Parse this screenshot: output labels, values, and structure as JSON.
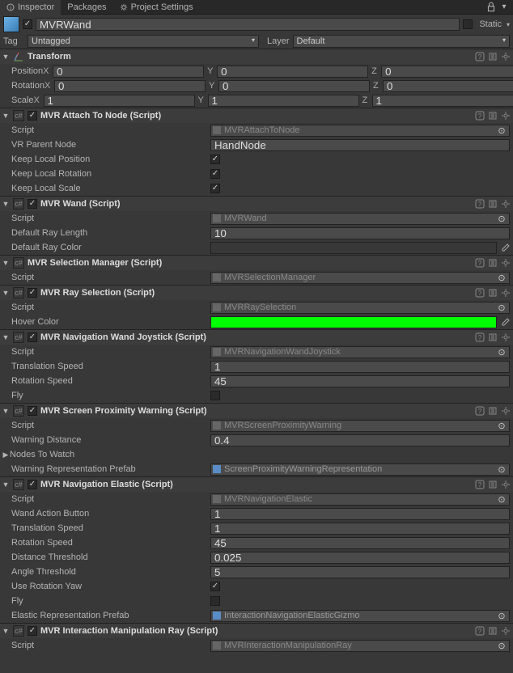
{
  "tabs": {
    "inspector": "Inspector",
    "packages": "Packages",
    "projectSettings": "Project Settings"
  },
  "header": {
    "nameChecked": true,
    "name": "MVRWand",
    "staticLabel": "Static",
    "staticChecked": false
  },
  "tagRow": {
    "tagLabel": "Tag",
    "tagValue": "Untagged",
    "layerLabel": "Layer",
    "layerValue": "Default"
  },
  "transform": {
    "title": "Transform",
    "positionLabel": "Position",
    "position": {
      "x": "0",
      "y": "0",
      "z": "0"
    },
    "rotationLabel": "Rotation",
    "rotation": {
      "x": "0",
      "y": "0",
      "z": "0"
    },
    "scaleLabel": "Scale",
    "scale": {
      "x": "1",
      "y": "1",
      "z": "1"
    }
  },
  "attachToNode": {
    "title": "MVR Attach To Node (Script)",
    "enabled": true,
    "scriptLabel": "Script",
    "scriptValue": "MVRAttachToNode",
    "parentLabel": "VR Parent Node",
    "parentValue": "HandNode",
    "keepPosLabel": "Keep Local Position",
    "keepPos": true,
    "keepRotLabel": "Keep Local Rotation",
    "keepRot": true,
    "keepScaleLabel": "Keep Local Scale",
    "keepScale": true
  },
  "wand": {
    "title": "MVR Wand (Script)",
    "enabled": true,
    "scriptLabel": "Script",
    "scriptValue": "MVRWand",
    "rayLenLabel": "Default Ray Length",
    "rayLen": "10",
    "rayColorLabel": "Default Ray Color",
    "rayColor": "#ffffff"
  },
  "selMgr": {
    "title": "MVR Selection Manager (Script)",
    "enabled": false,
    "scriptLabel": "Script",
    "scriptValue": "MVRSelectionManager"
  },
  "raySel": {
    "title": "MVR Ray Selection (Script)",
    "enabled": true,
    "scriptLabel": "Script",
    "scriptValue": "MVRRaySelection",
    "hoverLabel": "Hover Color",
    "hoverColor": "#00ff00"
  },
  "navJoy": {
    "title": "MVR Navigation Wand Joystick (Script)",
    "enabled": true,
    "scriptLabel": "Script",
    "scriptValue": "MVRNavigationWandJoystick",
    "transSpeedLabel": "Translation Speed",
    "transSpeed": "1",
    "rotSpeedLabel": "Rotation Speed",
    "rotSpeed": "45",
    "flyLabel": "Fly",
    "fly": false
  },
  "proxWarn": {
    "title": "MVR Screen Proximity Warning (Script)",
    "enabled": true,
    "scriptLabel": "Script",
    "scriptValue": "MVRScreenProximityWarning",
    "distLabel": "Warning Distance",
    "dist": "0.4",
    "nodesLabel": "Nodes To Watch",
    "reprLabel": "Warning Representation Prefab",
    "reprValue": "ScreenProximityWarningRepresentation"
  },
  "navElastic": {
    "title": "MVR Navigation Elastic (Script)",
    "enabled": true,
    "scriptLabel": "Script",
    "scriptValue": "MVRNavigationElastic",
    "btnLabel": "Wand Action Button",
    "btn": "1",
    "transSpeedLabel": "Translation Speed",
    "transSpeed": "1",
    "rotSpeedLabel": "Rotation Speed",
    "rotSpeed": "45",
    "distThreshLabel": "Distance Threshold",
    "distThresh": "0.025",
    "angleThreshLabel": "Angle Threshold",
    "angleThresh": "5",
    "yawLabel": "Use Rotation Yaw",
    "yaw": true,
    "flyLabel": "Fly",
    "fly": false,
    "reprLabel": "Elastic Representation Prefab",
    "reprValue": "InteractionNavigationElasticGizmo"
  },
  "manipRay": {
    "title": "MVR Interaction Manipulation Ray (Script)",
    "enabled": true,
    "scriptLabel": "Script",
    "scriptValue": "MVRInteractionManipulationRay"
  },
  "axes": {
    "x": "X",
    "y": "Y",
    "z": "Z"
  }
}
